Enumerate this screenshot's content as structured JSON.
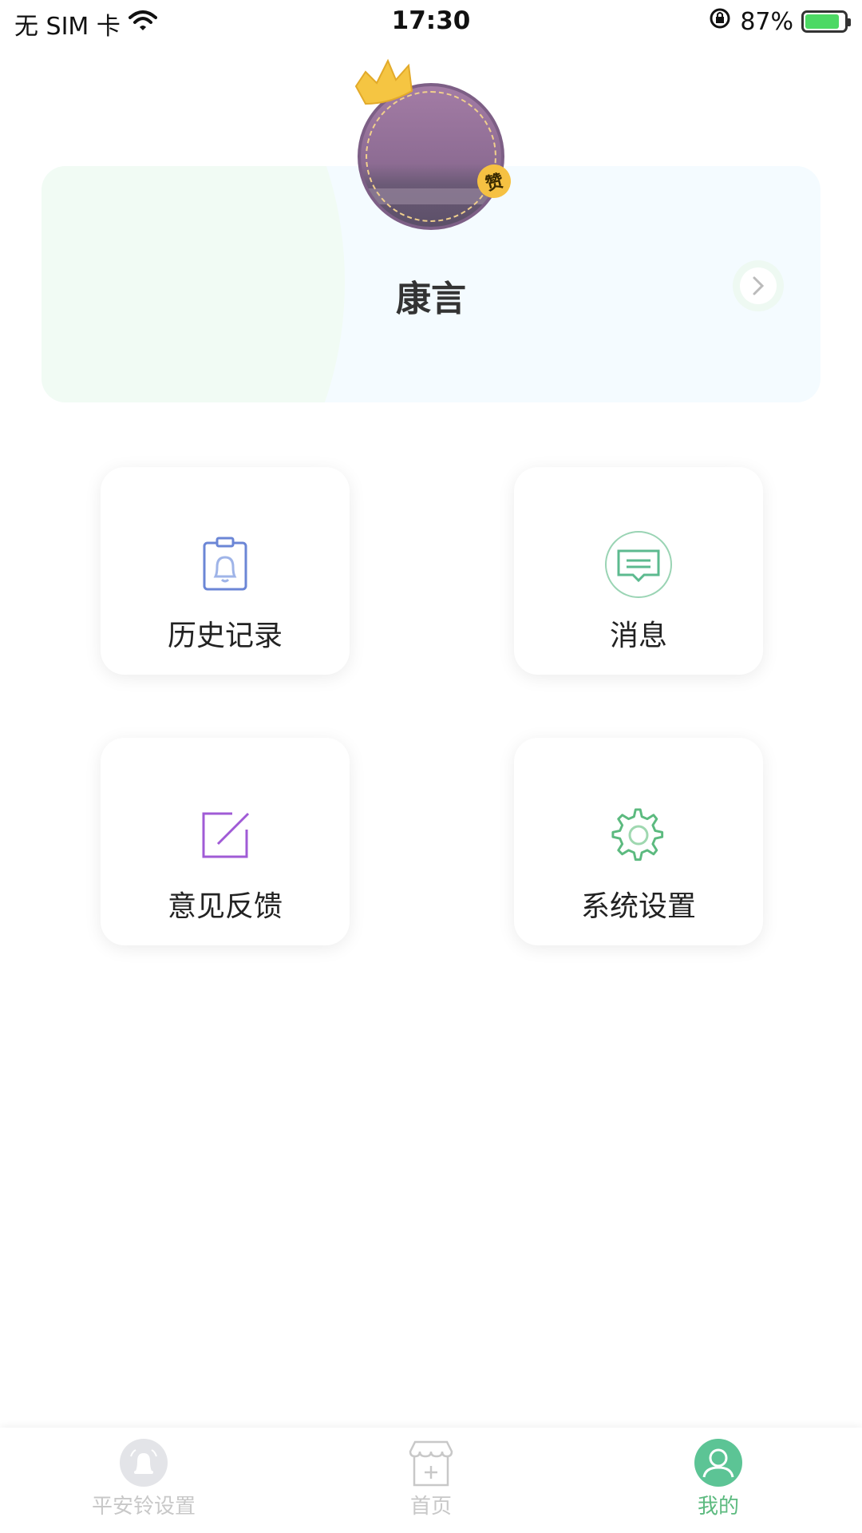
{
  "status_bar": {
    "carrier": "无 SIM 卡",
    "time": "17:30",
    "battery_text": "87%",
    "battery_level": 0.87
  },
  "profile": {
    "name": "康言",
    "badge": "赞"
  },
  "tiles": [
    {
      "label": "历史记录",
      "icon": "history-bell-icon",
      "color": "#6b86d6"
    },
    {
      "label": "消息",
      "icon": "message-icon",
      "color": "#5cba8f"
    },
    {
      "label": "意见反馈",
      "icon": "feedback-edit-icon",
      "color": "#a05bd6"
    },
    {
      "label": "系统设置",
      "icon": "gear-icon",
      "color": "#5cba7f"
    }
  ],
  "tabbar": {
    "tabs": [
      {
        "label": "平安铃设置",
        "icon": "alarm-bell-icon",
        "active": false
      },
      {
        "label": "首页",
        "icon": "store-icon",
        "active": false
      },
      {
        "label": "我的",
        "icon": "user-icon",
        "active": true
      }
    ]
  },
  "colors": {
    "accent": "#5cba7f",
    "card_bg": "#f4fbff",
    "badge": "#f6c142"
  }
}
